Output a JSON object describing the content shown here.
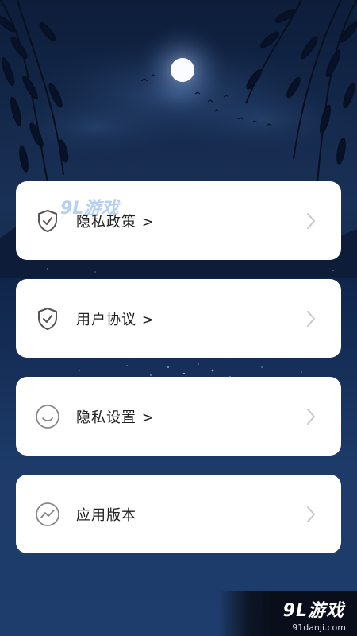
{
  "menu": {
    "items": [
      {
        "label": "隐私政策 >",
        "icon": "shield-check-icon"
      },
      {
        "label": "用户协议 >",
        "icon": "shield-check-icon"
      },
      {
        "label": "隐私设置 >",
        "icon": "smile-face-icon"
      },
      {
        "label": "应用版本",
        "icon": "activity-wave-icon"
      }
    ],
    "chevron_icon": "chevron-right-icon"
  },
  "watermark": {
    "overlay_text": "9L游戏",
    "brand": "9L游戏",
    "domain": "91danji.com"
  },
  "colors": {
    "card_bg": "#ffffff",
    "label_text": "#222222",
    "icon_stroke": "#555555",
    "chevron": "#c7c7c7",
    "sky_dark": "#0d1d3a",
    "sky_light": "#1f3d6c"
  }
}
